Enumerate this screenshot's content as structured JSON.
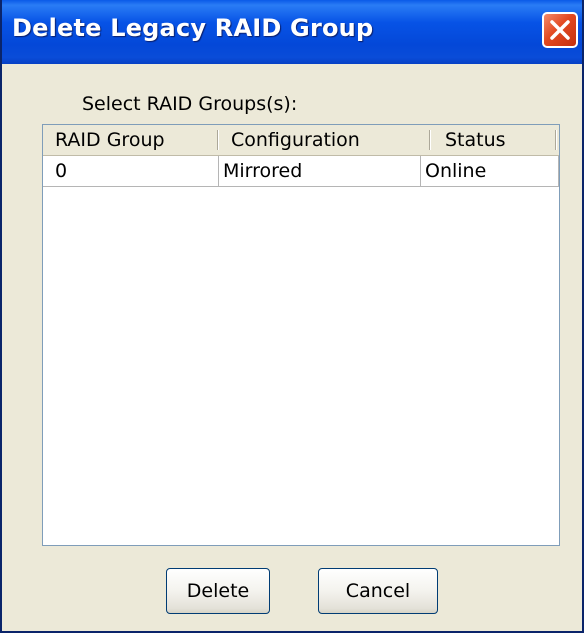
{
  "window": {
    "title": "Delete Legacy RAID Group",
    "close_icon": "close-icon"
  },
  "prompt": {
    "label": "Select RAID Groups(s):"
  },
  "table": {
    "columns": [
      "RAID Group",
      "Configuration",
      "Status"
    ],
    "rows": [
      [
        "0",
        "Mirrored",
        "Online"
      ]
    ]
  },
  "buttons": {
    "delete": {
      "mnemonic": "D",
      "rest": "elete"
    },
    "cancel": {
      "mnemonic": "C",
      "rest": "ancel"
    }
  },
  "colors": {
    "titlebar": "#0753e6",
    "close": "#e24820",
    "dialog_bg": "#ece9d8"
  }
}
